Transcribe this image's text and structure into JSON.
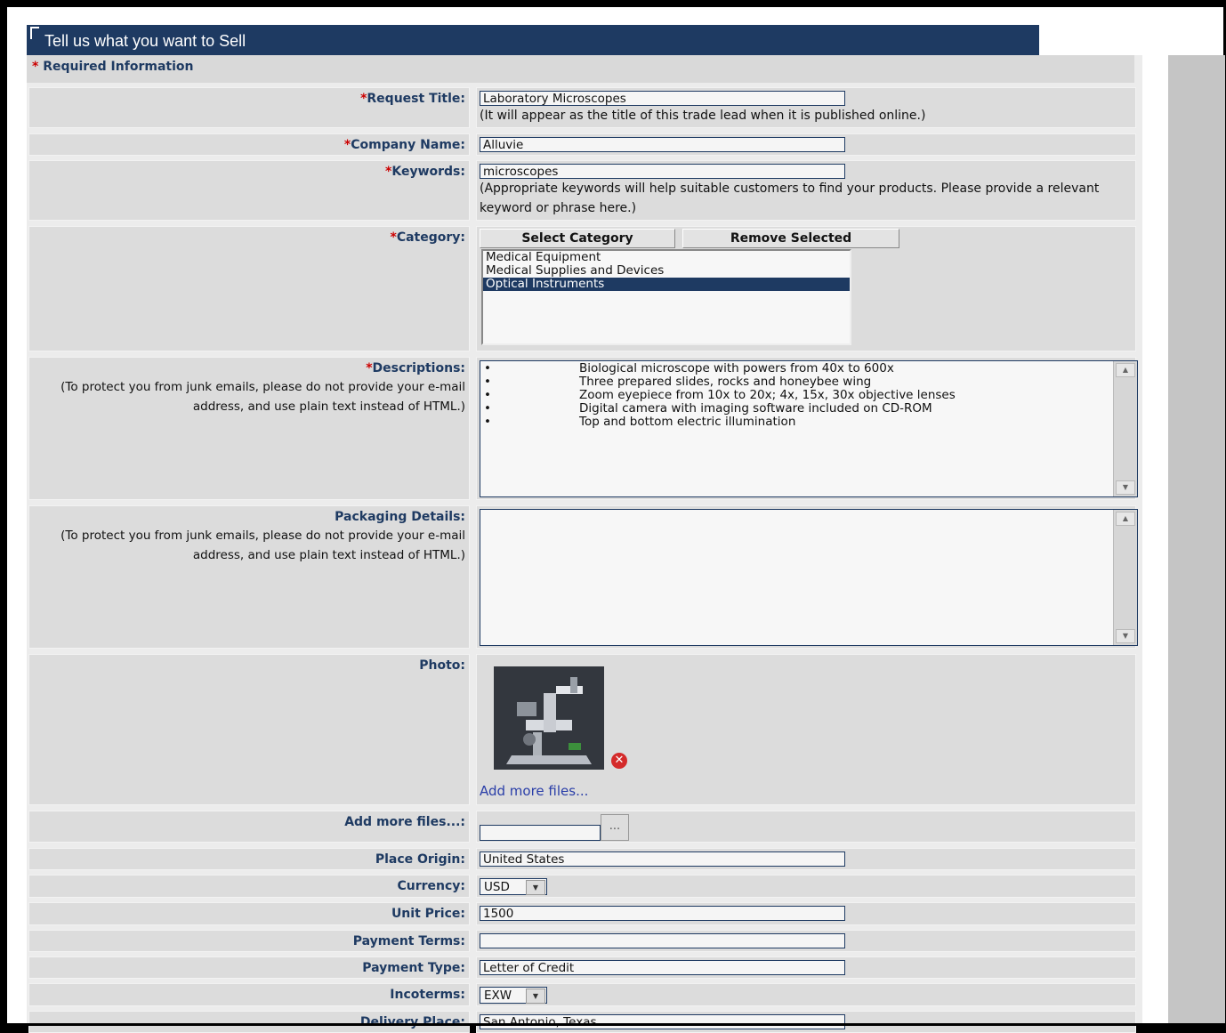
{
  "header": {
    "title": "Tell us what you want to Sell"
  },
  "required_note": {
    "star": "*",
    "text": "Required Information"
  },
  "fields": {
    "request_title": {
      "label": "Request Title:",
      "value": "Laboratory Microscopes",
      "hint": "(It will appear as the title of this trade lead when it is published online.)"
    },
    "company_name": {
      "label": "Company Name:",
      "value": "Alluvie"
    },
    "keywords": {
      "label": "Keywords:",
      "value": "microscopes",
      "hint": "(Appropriate keywords will help suitable customers to find your products. Please provide a relevant keyword or phrase here.)"
    },
    "category": {
      "label": "Category:",
      "select_button": "Select Category",
      "remove_button": "Remove Selected",
      "options": [
        "Medical Equipment",
        "Medical Supplies and Devices",
        "Optical Instruments"
      ],
      "selected": "Optical Instruments"
    },
    "descriptions": {
      "label": "Descriptions:",
      "note": "(To protect you from junk emails, please do not provide your e-mail address, and use plain text instead of HTML.)",
      "bullet": "•",
      "lines": [
        "Biological microscope with powers from 40x to 600x",
        "Three prepared slides, rocks and honeybee wing",
        "Zoom eyepiece from 10x to 20x; 4x, 15x, 30x objective lenses",
        "Digital camera with imaging software included on CD-ROM",
        "Top and bottom electric illumination"
      ]
    },
    "packaging": {
      "label": "Packaging Details:",
      "note": "(To protect you from junk emails, please do not provide your e-mail address, and use plain text instead of HTML.)",
      "value": ""
    },
    "photo": {
      "label": "Photo:",
      "add_link": "Add more files..."
    },
    "add_files": {
      "label": "Add more files...:",
      "browse": "..."
    },
    "place_origin": {
      "label": "Place Origin:",
      "value": "United States"
    },
    "currency": {
      "label": "Currency:",
      "value": "USD"
    },
    "unit_price": {
      "label": "Unit Price:",
      "value": "1500"
    },
    "payment_terms": {
      "label": "Payment Terms:",
      "value": ""
    },
    "payment_type": {
      "label": "Payment Type:",
      "value": "Letter of Credit"
    },
    "incoterms": {
      "label": "Incoterms:",
      "value": "EXW"
    },
    "delivery_place": {
      "label": "Delivery Place:",
      "value": "San Antonio, Texas"
    }
  },
  "required_star": "*",
  "colors": {
    "header_bg": "#1e3a62",
    "label_text": "#1e3a62",
    "required_star": "#cc0000",
    "row_bg": "#dcdcdc"
  }
}
